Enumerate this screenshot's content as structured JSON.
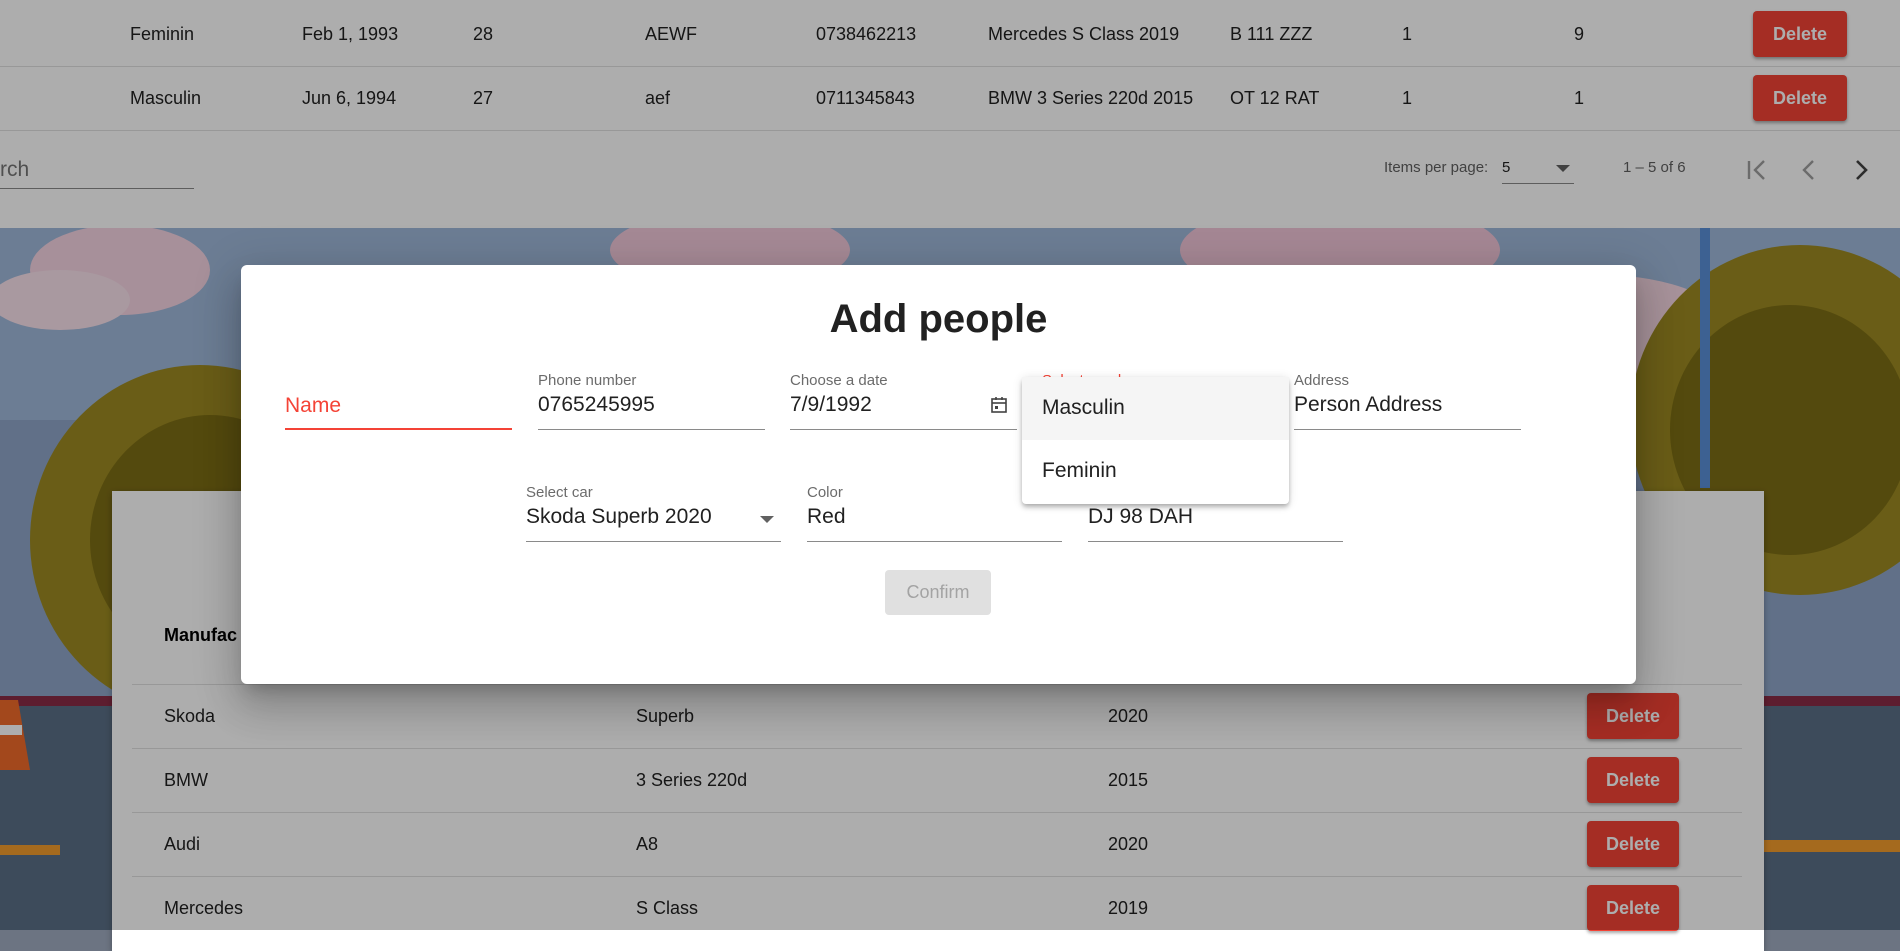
{
  "people_table": {
    "rows": [
      {
        "gender": "Feminin",
        "birthdate": "Feb 1, 1993",
        "age": "28",
        "address": "AEWF",
        "phone": "0738462213",
        "car": "Mercedes S Class 2019",
        "plate": "B 111 ZZZ",
        "col8": "1",
        "col9": "9",
        "delete_label": "Delete"
      },
      {
        "gender": "Masculin",
        "birthdate": "Jun 6, 1994",
        "age": "27",
        "address": "aef",
        "phone": "0711345843",
        "car": "BMW 3 Series 220d 2015",
        "plate": "OT 12 RAT",
        "col8": "1",
        "col9": "1",
        "delete_label": "Delete"
      }
    ],
    "search": {
      "placeholder": "rch"
    },
    "paginator": {
      "items_per_page_label": "Items per page:",
      "items_per_page_value": "5",
      "range_label": "1 – 5 of 6"
    }
  },
  "cars_table": {
    "header_partial": "Manufac",
    "rows": [
      {
        "manufacturer": "Skoda",
        "model": "Superb",
        "year": "2020",
        "delete_label": "Delete"
      },
      {
        "manufacturer": "BMW",
        "model": "3 Series 220d",
        "year": "2015",
        "delete_label": "Delete"
      },
      {
        "manufacturer": "Audi",
        "model": "A8",
        "year": "2020",
        "delete_label": "Delete"
      },
      {
        "manufacturer": "Mercedes",
        "model": "S Class",
        "year": "2019",
        "delete_label": "Delete"
      }
    ]
  },
  "dialog": {
    "title": "Add people",
    "name": {
      "placeholder": "Name"
    },
    "phone": {
      "label": "Phone number",
      "value": "0765245995"
    },
    "date": {
      "label": "Choose a date",
      "value": "7/9/1992"
    },
    "gender": {
      "label": "Select gender",
      "options": [
        "Masculin",
        "Feminin"
      ]
    },
    "address": {
      "label": "Address",
      "value": "Person Address"
    },
    "car": {
      "label": "Select car",
      "value": "Skoda Superb 2020"
    },
    "color": {
      "label": "Color",
      "value": "Red"
    },
    "plate": {
      "value": "DJ 98 DAH"
    },
    "confirm_label": "Confirm"
  },
  "colors": {
    "accent": "#f44336",
    "overlay": "rgba(0,0,0,0.32)",
    "disabled_bg": "#e0e0e0"
  }
}
